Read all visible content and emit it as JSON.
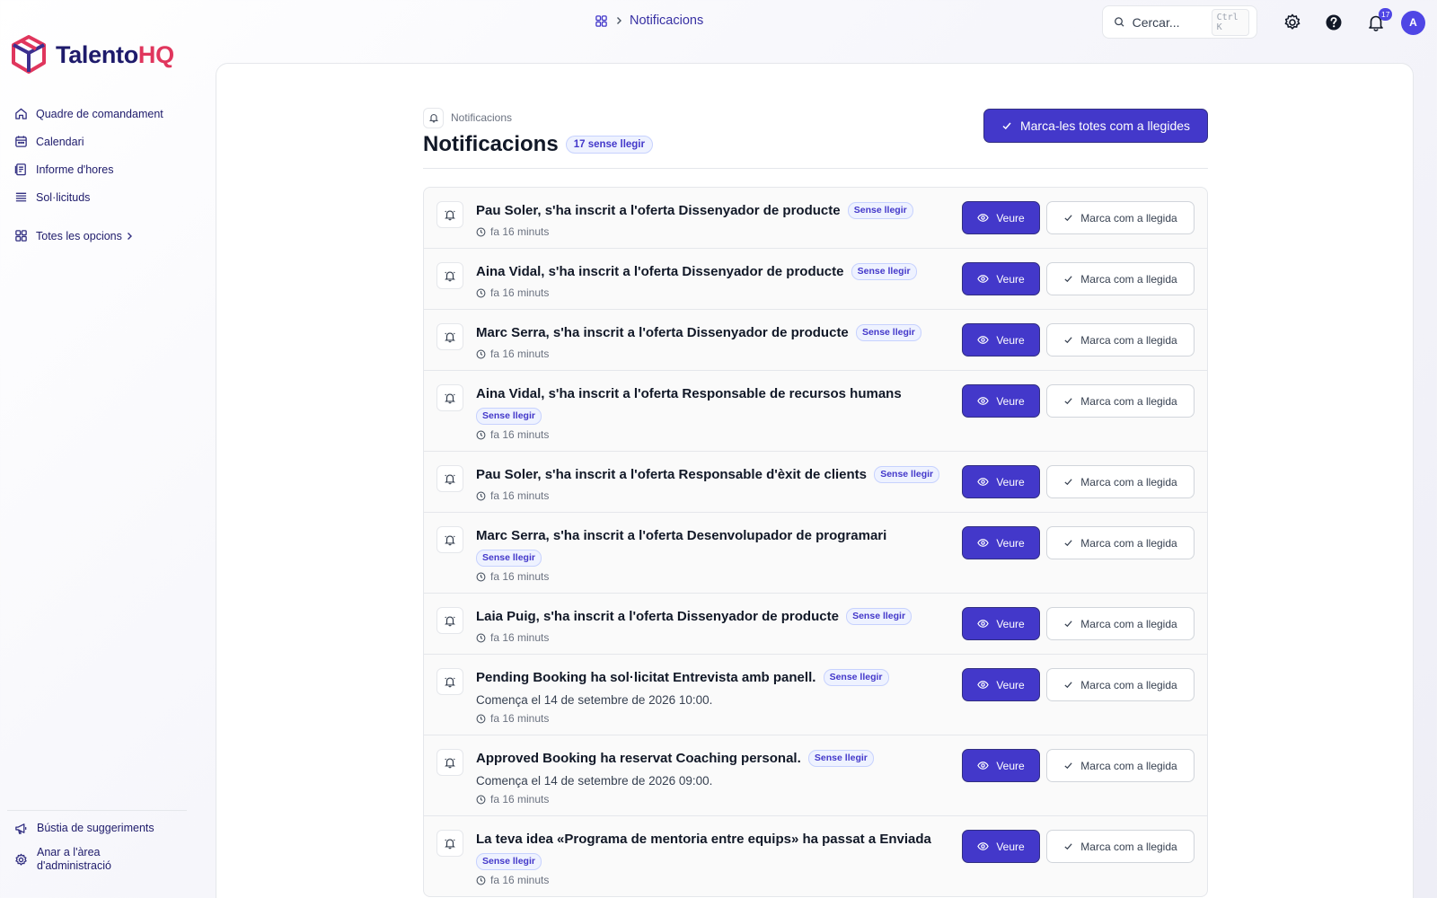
{
  "brand": {
    "name_part1": "Talento",
    "name_part2": "HQ",
    "primary_color": "#1e1b6b",
    "accent_color": "#e0365d"
  },
  "sidebar": {
    "items": [
      {
        "label": "Quadre de comandament",
        "icon": "home-icon"
      },
      {
        "label": "Calendari",
        "icon": "calendar-icon"
      },
      {
        "label": "Informe d'hores",
        "icon": "report-icon"
      },
      {
        "label": "Sol·licituds",
        "icon": "list-icon"
      }
    ],
    "all_options_label": "Totes les opcions",
    "bottom": {
      "suggestions_label": "Bústia de suggeriments",
      "admin_label": "Anar a l'àrea d'administració"
    }
  },
  "topbar": {
    "breadcrumb": "Notificacions",
    "search_placeholder": "Cercar...",
    "search_shortcut": "Ctrl K",
    "notification_count": "17",
    "avatar_initial": "A"
  },
  "page": {
    "breadcrumb": "Notificacions",
    "title": "Notificacions",
    "unread_summary": "17 sense llegir",
    "mark_all_label": "Marca-les totes com a llegides",
    "accent_color": "#4338ca"
  },
  "notifications": [
    {
      "title": "Pau Soler, s'ha inscrit a l'oferta Dissenyador de producte",
      "badge": "Sense llegir",
      "badge_wrap": false,
      "desc": "",
      "time": "fa 16 minuts"
    },
    {
      "title": "Aina Vidal, s'ha inscrit a l'oferta Dissenyador de producte",
      "badge": "Sense llegir",
      "badge_wrap": false,
      "desc": "",
      "time": "fa 16 minuts"
    },
    {
      "title": "Marc Serra, s'ha inscrit a l'oferta Dissenyador de producte",
      "badge": "Sense llegir",
      "badge_wrap": false,
      "desc": "",
      "time": "fa 16 minuts"
    },
    {
      "title": "Aina Vidal, s'ha inscrit a l'oferta Responsable de recursos humans",
      "badge": "Sense llegir",
      "badge_wrap": true,
      "desc": "",
      "time": "fa 16 minuts"
    },
    {
      "title": "Pau Soler, s'ha inscrit a l'oferta Responsable d'èxit de clients",
      "badge": "Sense llegir",
      "badge_wrap": false,
      "desc": "",
      "time": "fa 16 minuts"
    },
    {
      "title": "Marc Serra, s'ha inscrit a l'oferta Desenvolupador de programari",
      "badge": "Sense llegir",
      "badge_wrap": true,
      "desc": "",
      "time": "fa 16 minuts"
    },
    {
      "title": "Laia Puig, s'ha inscrit a l'oferta Dissenyador de producte",
      "badge": "Sense llegir",
      "badge_wrap": false,
      "desc": "",
      "time": "fa 16 minuts"
    },
    {
      "title": "Pending Booking ha sol·licitat Entrevista amb panell.",
      "badge": "Sense llegir",
      "badge_wrap": false,
      "desc": "Comença el 14 de setembre de 2026 10:00.",
      "time": "fa 16 minuts"
    },
    {
      "title": "Approved Booking ha reservat Coaching personal.",
      "badge": "Sense llegir",
      "badge_wrap": false,
      "desc": "Comença el 14 de setembre de 2026 09:00.",
      "time": "fa 16 minuts"
    },
    {
      "title": "La teva idea «Programa de mentoria entre equips» ha passat a Enviada",
      "badge": "Sense llegir",
      "badge_wrap": true,
      "desc": "",
      "time": "fa 16 minuts"
    }
  ],
  "actions": {
    "view_label": "Veure",
    "mark_read_label": "Marca com a llegida"
  }
}
